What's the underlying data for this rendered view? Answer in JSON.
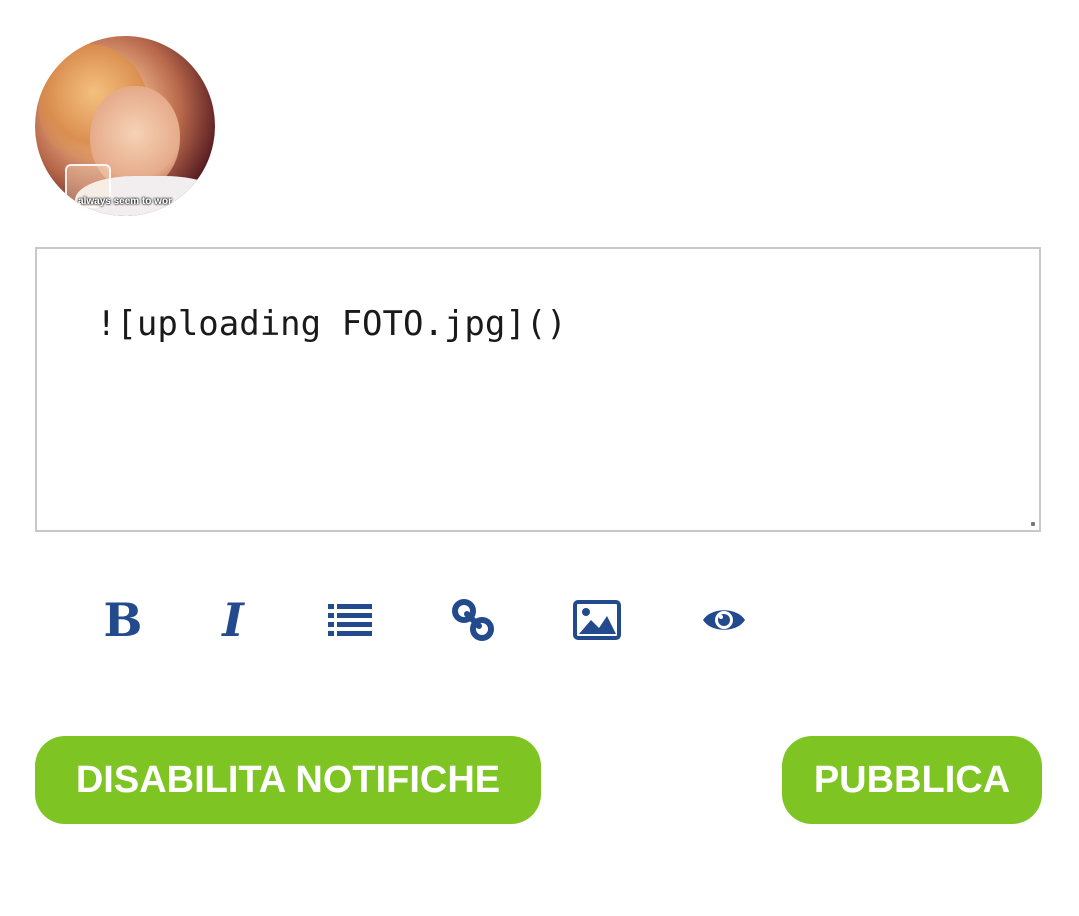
{
  "profile": {
    "avatar_caption": "always seem to wor"
  },
  "editor": {
    "value": "![uploading FOTO.jpg]()"
  },
  "toolbar": {
    "bold_label": "B",
    "italic_label": "I",
    "icons": [
      "bold-icon",
      "italic-icon",
      "list-icon",
      "link-icon",
      "image-icon",
      "preview-eye-icon"
    ],
    "icon_color": "#234a8c"
  },
  "actions": {
    "disable_notifications_label": "DISABILITA NOTIFICHE",
    "publish_label": "PUBBLICA",
    "button_color": "#7ec524"
  }
}
